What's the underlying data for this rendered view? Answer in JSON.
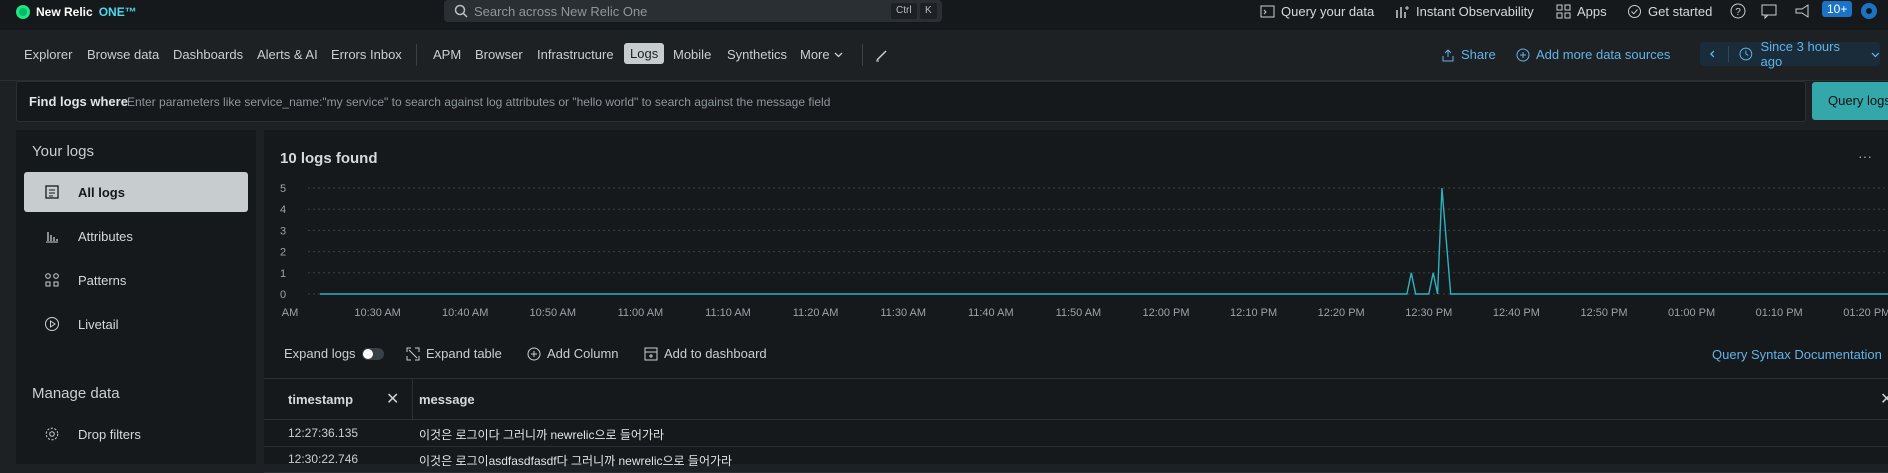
{
  "topbar": {
    "brand": "New Relic",
    "brand_suffix": "ONE™",
    "search_placeholder": "Search across New Relic One",
    "shortcut_ctrl": "Ctrl",
    "shortcut_k": "K",
    "query_your_data": "Query your data",
    "instant_observability": "Instant Observability",
    "apps": "Apps",
    "get_started": "Get started",
    "notification_count": "10+"
  },
  "nav": {
    "items": [
      "Explorer",
      "Browse data",
      "Dashboards",
      "Alerts & AI",
      "Errors Inbox",
      "APM",
      "Browser",
      "Infrastructure",
      "Logs",
      "Mobile",
      "Synthetics",
      "More"
    ],
    "active": "Logs",
    "share": "Share",
    "add_data": "Add more data sources",
    "time_range": "Since 3 hours ago"
  },
  "find": {
    "label": "Find logs where",
    "placeholder": "Enter parameters like service_name:\"my service\" to search against log attributes or \"hello world\" to search against the message field",
    "button": "Query logs"
  },
  "sidebar": {
    "your_logs": "Your logs",
    "items": [
      {
        "label": "All logs",
        "icon": "list-icon"
      },
      {
        "label": "Attributes",
        "icon": "bar-chart-icon"
      },
      {
        "label": "Patterns",
        "icon": "patterns-icon"
      },
      {
        "label": "Livetail",
        "icon": "play-icon"
      }
    ],
    "manage_data": "Manage data",
    "drop_filters": "Drop filters"
  },
  "main": {
    "logs_found": "10 logs found",
    "more": "···",
    "expand_logs": "Expand logs",
    "expand_table": "Expand table",
    "add_column": "Add Column",
    "add_to_dashboard": "Add to dashboard",
    "query_syntax": "Query Syntax Documentation"
  },
  "chart_data": {
    "type": "line",
    "x": [
      "AM",
      "10:30 AM",
      "10:40 AM",
      "10:50 AM",
      "11:00 AM",
      "11:10 AM",
      "11:20 AM",
      "11:30 AM",
      "11:40 AM",
      "11:50 AM",
      "12:00 PM",
      "12:10 PM",
      "12:20 PM",
      "12:30 PM",
      "12:40 PM",
      "12:50 PM",
      "01:00 PM",
      "01:10 PM",
      "01:20 PM"
    ],
    "y_ticks": [
      "5",
      "4",
      "3",
      "2",
      "1",
      "0"
    ],
    "ylim": [
      0,
      5
    ],
    "series": [
      {
        "color": "#2bb3c0",
        "points": [
          [
            0,
            0
          ],
          [
            12.75,
            0
          ],
          [
            12.8,
            1
          ],
          [
            12.85,
            0
          ],
          [
            13.0,
            0
          ],
          [
            13.05,
            1
          ],
          [
            13.1,
            0
          ],
          [
            13.15,
            5
          ],
          [
            13.25,
            0
          ],
          [
            18.5,
            0
          ]
        ]
      }
    ]
  },
  "table": {
    "col_timestamp": "timestamp",
    "col_message": "message",
    "close_glyph": "✕",
    "rows": [
      {
        "timestamp": "12:27:36.135",
        "message": "이것은 로그이다 그러니까 newrelic으로 들어가라"
      },
      {
        "timestamp": "12:30:22.746",
        "message": "이것은 로그이asdfasdfasdf다 그러니까 newrelic으로 들어가라"
      }
    ]
  }
}
